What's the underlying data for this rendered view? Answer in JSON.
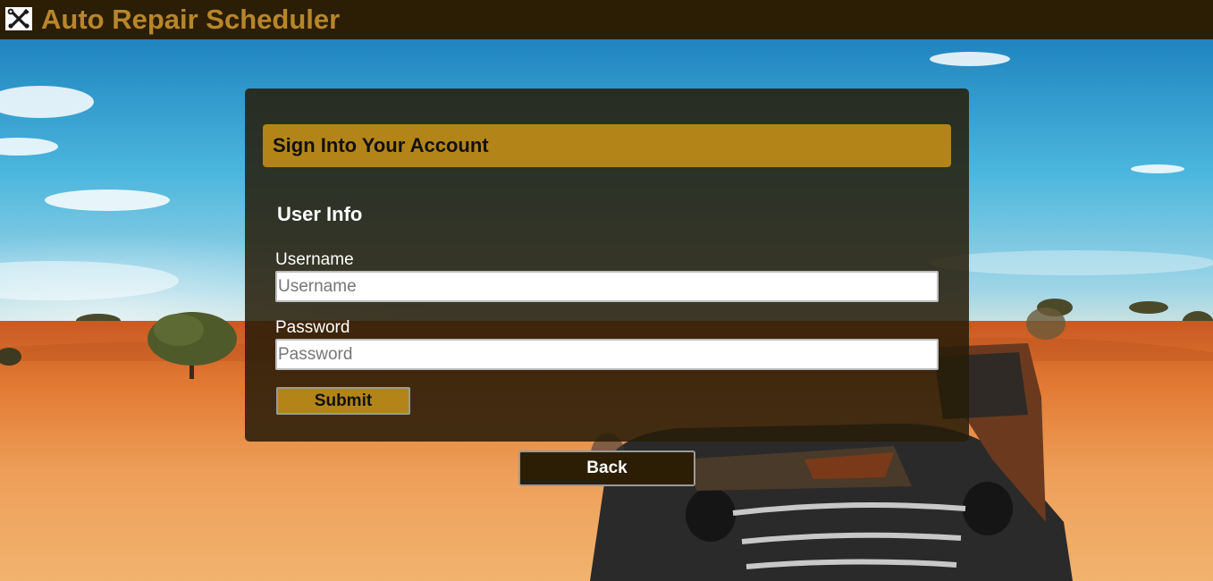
{
  "header": {
    "title": "Auto Repair Scheduler",
    "logo_icon": "wrench-screwdriver-icon"
  },
  "sign_in": {
    "title": "Sign Into Your Account",
    "section_heading": "User Info",
    "username": {
      "label": "Username",
      "placeholder": "Username",
      "value": ""
    },
    "password": {
      "label": "Password",
      "placeholder": "Password",
      "value": ""
    },
    "submit_label": "Submit"
  },
  "back_label": "Back",
  "colors": {
    "header_bg": "#2b1e05",
    "brand_gold": "#b8862a",
    "accent_gold": "#b38519",
    "panel_bg": "#261c08"
  },
  "background_image": "desert-abandoned-car-photo"
}
